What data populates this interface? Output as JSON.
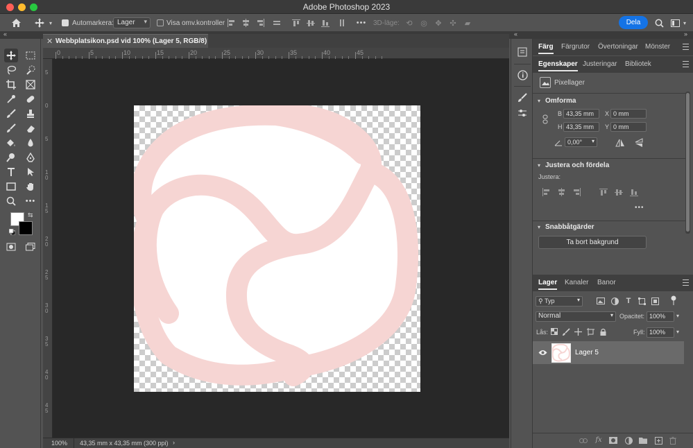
{
  "window": {
    "title": "Adobe Photoshop 2023"
  },
  "options_bar": {
    "auto_select_label": "Automarkera:",
    "auto_select_target": "Lager",
    "show_transform_label": "Visa omv.kontroller",
    "mode_3d_label": "3D-läge:",
    "share_label": "Dela",
    "more_label": "•••"
  },
  "document": {
    "tab_title": "Webbplatsikon.psd vid 100% (Lager 5, RGB/8)",
    "zoom": "100%",
    "dimensions": "43,35 mm x 43,35 mm (300 ppi)"
  },
  "rulers": {
    "top": [
      "0",
      "5",
      "10",
      "15",
      "20",
      "25",
      "30",
      "35",
      "40",
      "45"
    ],
    "left": [
      "5",
      "0",
      "5",
      "1 0",
      "1 5",
      "2 0",
      "2 5",
      "3 0",
      "3 5",
      "4 0",
      "4 5"
    ]
  },
  "colors": {
    "foreground": "#ffffff",
    "background": "#000000",
    "shape_fill": "#f6d5d3",
    "accent": "#1473e6"
  },
  "panels": {
    "top_tabs": [
      "Färg",
      "Färgrutor",
      "Övertoningar",
      "Mönster"
    ],
    "mid_tabs": [
      "Egenskaper",
      "Justeringar",
      "Bibliotek"
    ],
    "properties": {
      "layer_kind": "Pixellager",
      "transform_title": "Omforma",
      "w_label": "B",
      "w_value": "43,35 mm",
      "h_label": "H",
      "h_value": "43,35 mm",
      "x_label": "X",
      "x_value": "0 mm",
      "y_label": "Y",
      "y_value": "0 mm",
      "angle_value": "0,00°",
      "align_title": "Justera och fördela",
      "align_label": "Justera:",
      "quick_actions_title": "Snabbåtgärder",
      "remove_bg_label": "Ta bort bakgrund",
      "more_label": "•••"
    },
    "layers_tabs": [
      "Lager",
      "Kanaler",
      "Banor"
    ],
    "layers": {
      "filter_label": "Typ",
      "blend_mode": "Normal",
      "opacity_label": "Opacitet:",
      "opacity_value": "100%",
      "lock_label": "Lås:",
      "fill_label": "Fyll:",
      "fill_value": "100%",
      "items": [
        {
          "name": "Lager 5",
          "visible": true
        }
      ]
    }
  }
}
